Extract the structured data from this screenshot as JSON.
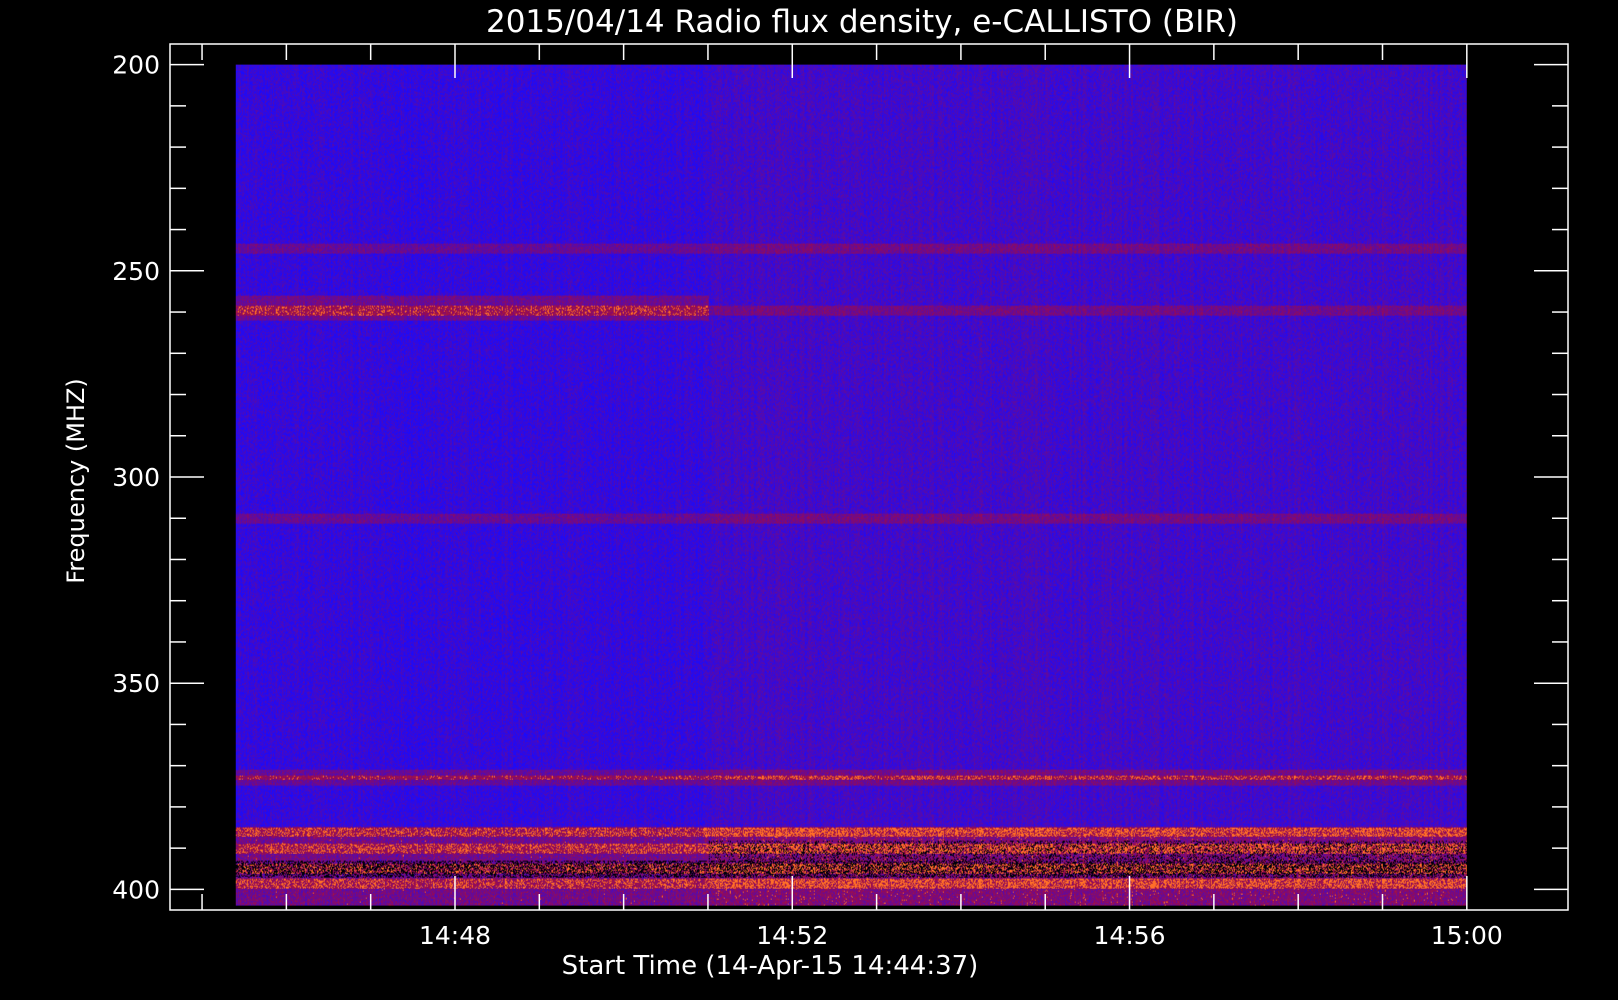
{
  "chart_data": {
    "type": "heatmap",
    "title": "2015/04/14  Radio flux density, e-CALLISTO (BIR)",
    "xlabel": "Start Time (14-Apr-15 14:44:37)",
    "ylabel": "Frequency (MHZ)",
    "x_tick_labels": [
      "14:48",
      "14:52",
      "14:56",
      "15:00"
    ],
    "x_ticks_minutes": [
      228,
      232,
      236,
      240
    ],
    "y_tick_labels": [
      "200",
      "250",
      "300",
      "350",
      "400"
    ],
    "y_ticks": [
      200,
      250,
      300,
      350,
      400
    ],
    "xlim_minutes": [
      224.62,
      241.2
    ],
    "ylim": [
      405,
      195
    ],
    "data_time_range_minutes": [
      225.4,
      240.0
    ],
    "data_freq_range": [
      200,
      404
    ],
    "grid": false,
    "colors": {
      "background": "#000000",
      "axes": "#ffffff",
      "low": "#1010ff",
      "mid": "#7a1040",
      "high": "#ff6020"
    },
    "features": {
      "instrument_switch_minutes": 231.0,
      "persistent_bands_mhz": [
        244.5,
        259.5,
        310,
        372,
        373.5,
        386,
        390,
        395,
        398.5
      ],
      "strong_emission_band_mhz": [
        385,
        404
      ]
    }
  }
}
